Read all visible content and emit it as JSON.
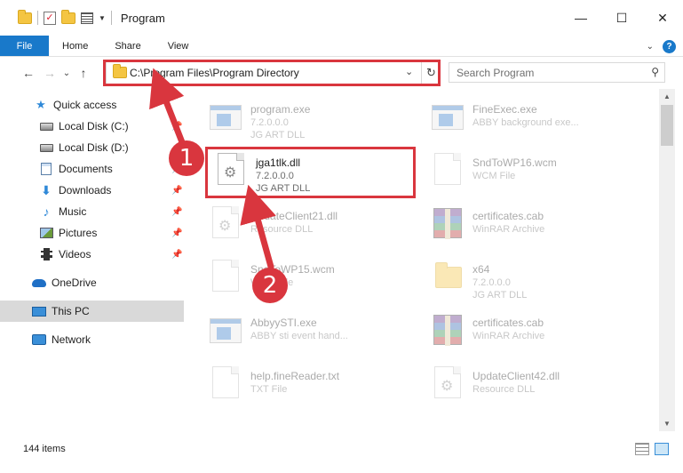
{
  "window": {
    "title": "Program",
    "minimize": "—",
    "maximize": "☐",
    "close": "✕"
  },
  "ribbon": {
    "tabs": [
      "File",
      "Home",
      "Share",
      "View"
    ],
    "expand": "⌄",
    "help": "?"
  },
  "nav": {
    "back": "←",
    "forward": "→",
    "recent": "⌄",
    "up": "↑",
    "address": "C:\\Program Files\\Program Directory",
    "address_dropdown": "⌄",
    "refresh": "↻",
    "search_placeholder": "Search Program",
    "search_icon": "⚲"
  },
  "sidebar": {
    "items": [
      {
        "label": "Quick access",
        "icon": "star-icon"
      },
      {
        "label": "Local Disk (C:)",
        "icon": "disk-icon",
        "pinned": true
      },
      {
        "label": "Local Disk (D:)",
        "icon": "disk-icon",
        "pinned": true
      },
      {
        "label": "Documents",
        "icon": "documents-icon",
        "pinned": true
      },
      {
        "label": "Downloads",
        "icon": "downloads-icon",
        "pinned": true
      },
      {
        "label": "Music",
        "icon": "music-icon",
        "pinned": true
      },
      {
        "label": "Pictures",
        "icon": "pictures-icon",
        "pinned": true
      },
      {
        "label": "Videos",
        "icon": "videos-icon",
        "pinned": true
      },
      {
        "label": "OneDrive",
        "icon": "onedrive-icon"
      },
      {
        "label": "This PC",
        "icon": "this-pc-icon",
        "selected": true
      },
      {
        "label": "Network",
        "icon": "network-icon"
      }
    ],
    "pin_glyph": "📌"
  },
  "files": [
    {
      "name": "program.exe",
      "line2": "7.2.0.0.0",
      "line3": "JG ART DLL",
      "icon": "exe-icon",
      "faded": true
    },
    {
      "name": "FineExec.exe",
      "line2": "ABBY background exe...",
      "line3": "",
      "icon": "exe-icon",
      "faded": true
    },
    {
      "name": "jga1tlk.dll",
      "line2": "7.2.0.0.0",
      "line3": "JG ART DLL",
      "icon": "dll-gear-icon",
      "faded": false
    },
    {
      "name": "SndToWP16.wcm",
      "line2": "WCM File",
      "line3": "",
      "icon": "blank-file-icon",
      "faded": true
    },
    {
      "name": "UpdateClient21.dll",
      "line2": "Resource DLL",
      "line3": "",
      "icon": "dll-gear-icon",
      "faded": true
    },
    {
      "name": "certificates.cab",
      "line2": "WinRAR Archive",
      "line3": "",
      "icon": "rar-icon",
      "faded": true
    },
    {
      "name": "SndToWP15.wcm",
      "line2": "WCM File",
      "line3": "",
      "icon": "blank-file-icon",
      "faded": true
    },
    {
      "name": "x64",
      "line2": "7.2.0.0.0",
      "line3": "JG ART DLL",
      "icon": "folder-icon",
      "faded": true
    },
    {
      "name": "AbbyySTI.exe",
      "line2": "ABBY sti event hand...",
      "line3": "",
      "icon": "exe-icon",
      "faded": true
    },
    {
      "name": "certificates.cab",
      "line2": "WinRAR Archive",
      "line3": "",
      "icon": "rar-icon",
      "faded": true
    },
    {
      "name": "help.fineReader.txt",
      "line2": "TXT File",
      "line3": "",
      "icon": "blank-file-icon",
      "faded": true
    },
    {
      "name": "UpdateClient42.dll",
      "line2": "Resource DLL",
      "line3": "",
      "icon": "dll-gear-icon",
      "faded": true
    }
  ],
  "status": {
    "count": "144 items"
  },
  "annotations": {
    "step1": "1",
    "step2": "2"
  },
  "colors": {
    "accent": "#1979ca",
    "highlight": "#d9363e"
  }
}
